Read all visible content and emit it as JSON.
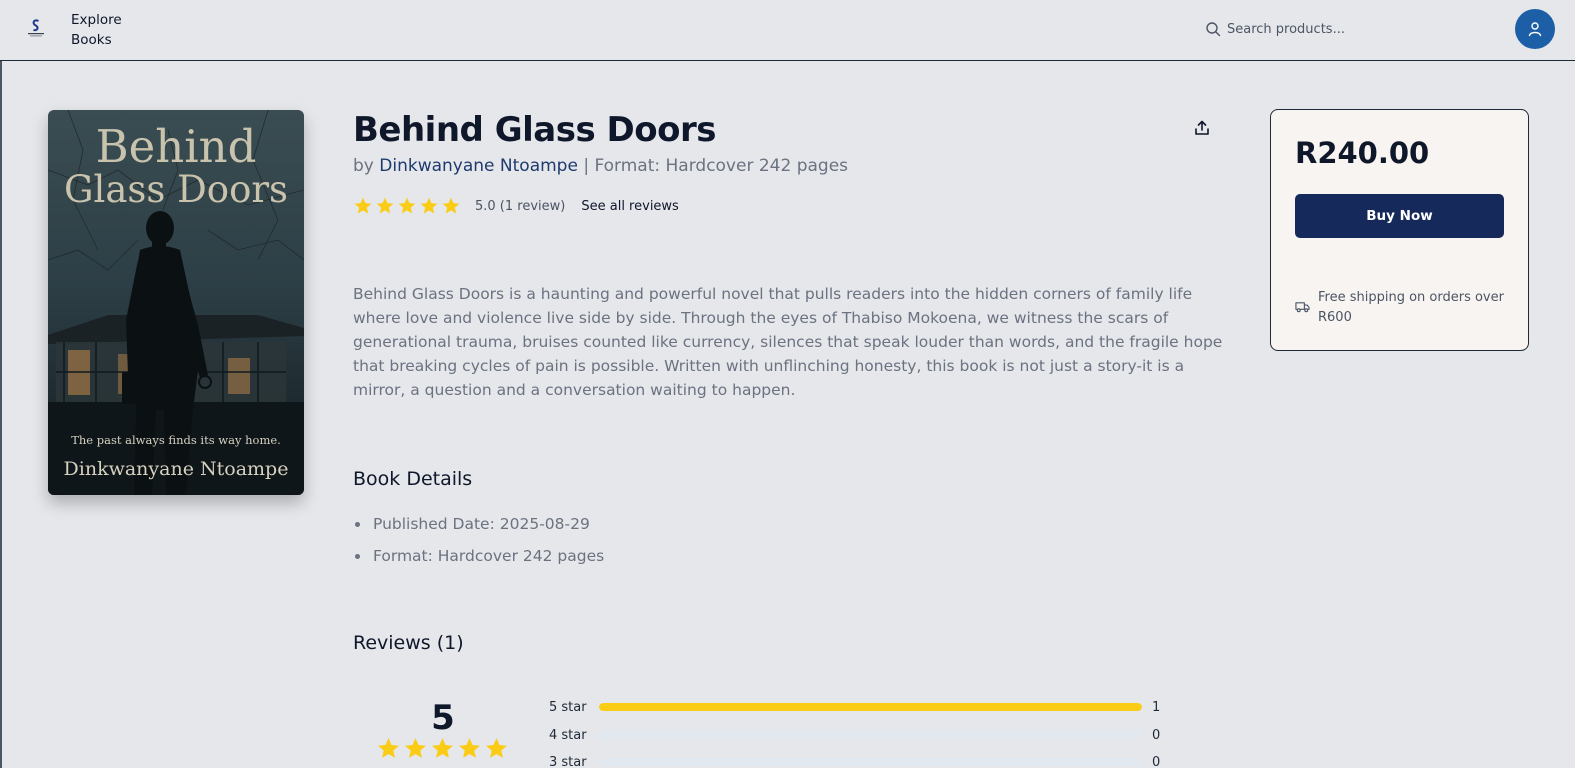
{
  "header": {
    "brand": "Explore Books",
    "search_placeholder": "Search products..."
  },
  "cover": {
    "title_line1": "Behind",
    "title_line2": "Glass Doors",
    "tagline": "The past always finds its way home.",
    "author": "Dinkwanyane Ntoampe"
  },
  "book": {
    "title": "Behind Glass Doors",
    "by_prefix": "by",
    "author": "Dinkwanyane Ntoampe",
    "separator": "|",
    "format_line": "Format: Hardcover 242 pages",
    "rating": 5.0,
    "rating_text": "5.0 (1 review)",
    "see_all_reviews": "See all reviews",
    "description": "Behind Glass Doors is a haunting and powerful novel that pulls readers into the hidden corners of family life where love and violence live side by side. Through the eyes of Thabiso Mokoena, we witness the scars of generational trauma, bruises counted like currency, silences that speak louder than words, and the fragile hope that breaking cycles of pain is possible. Written with unflinching honesty, this book is not just a story-it is a mirror, a question and a conversation waiting to happen."
  },
  "details": {
    "heading": "Book Details",
    "items": [
      "Published Date: 2025-08-29",
      "Format: Hardcover 242 pages"
    ]
  },
  "reviews": {
    "heading": "Reviews (1)",
    "average": "5",
    "breakdown": [
      {
        "label": "5 star",
        "count": "1",
        "fraction": 1.0
      },
      {
        "label": "4 star",
        "count": "0",
        "fraction": 0.0
      },
      {
        "label": "3 star",
        "count": "0",
        "fraction": 0.0
      }
    ]
  },
  "purchase": {
    "price": "R240.00",
    "buy_label": "Buy Now",
    "shipping_note": "Free shipping on orders over R600"
  },
  "colors": {
    "star": "#facc15",
    "primary": "#15295a",
    "avatar": "#1d5fa6"
  }
}
